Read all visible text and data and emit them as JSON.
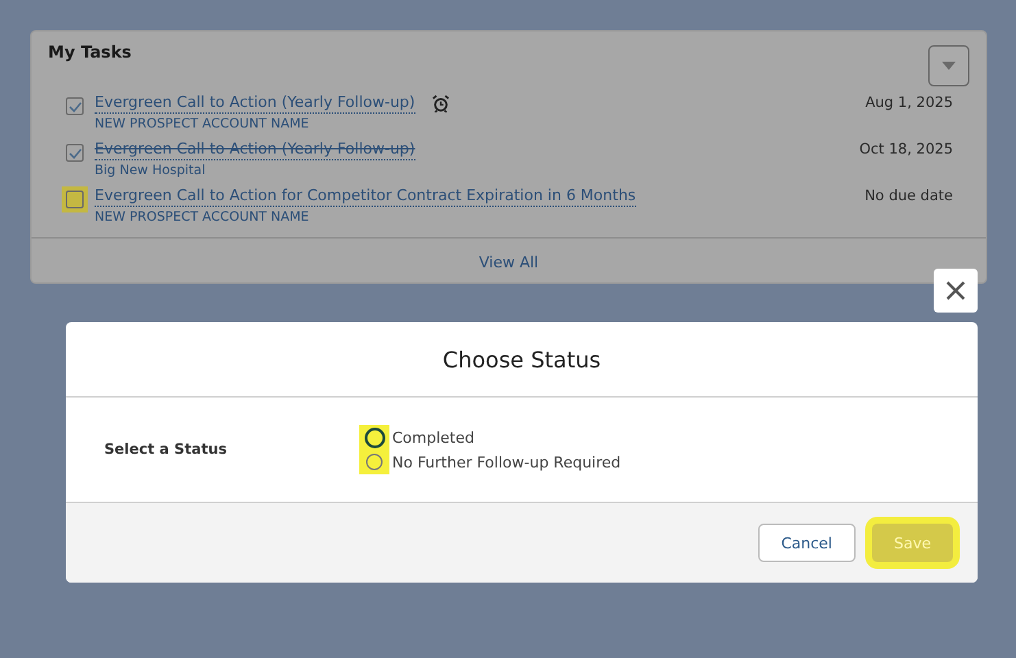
{
  "card": {
    "title": "My Tasks",
    "view_all": "View All"
  },
  "tasks": [
    {
      "title": "Evergreen Call to Action (Yearly Follow-up)",
      "account": "NEW PROSPECT ACCOUNT NAME",
      "date": "Aug 1, 2025",
      "checked": true,
      "completed": false,
      "highlighted": false,
      "reminder": true
    },
    {
      "title": "Evergreen Call to Action (Yearly Follow-up)",
      "account": "Big New Hospital",
      "date": "Oct 18, 2025",
      "checked": true,
      "completed": true,
      "highlighted": false,
      "reminder": false
    },
    {
      "title": "Evergreen Call to Action for Competitor Contract Expiration in 6 Months",
      "account": "NEW PROSPECT ACCOUNT NAME",
      "date": "No due date",
      "checked": false,
      "completed": false,
      "highlighted": true,
      "reminder": false
    }
  ],
  "modal": {
    "title": "Choose Status",
    "field_label": "Select a Status",
    "options": [
      {
        "label": "Completed",
        "selected": true,
        "highlighted": true
      },
      {
        "label": "No Further Follow-up Required",
        "selected": false,
        "highlighted": true
      }
    ],
    "buttons": [
      {
        "label": "Cancel",
        "kind": "neutral",
        "highlighted": false
      },
      {
        "label": "Save",
        "kind": "brand",
        "highlighted": true
      }
    ]
  }
}
